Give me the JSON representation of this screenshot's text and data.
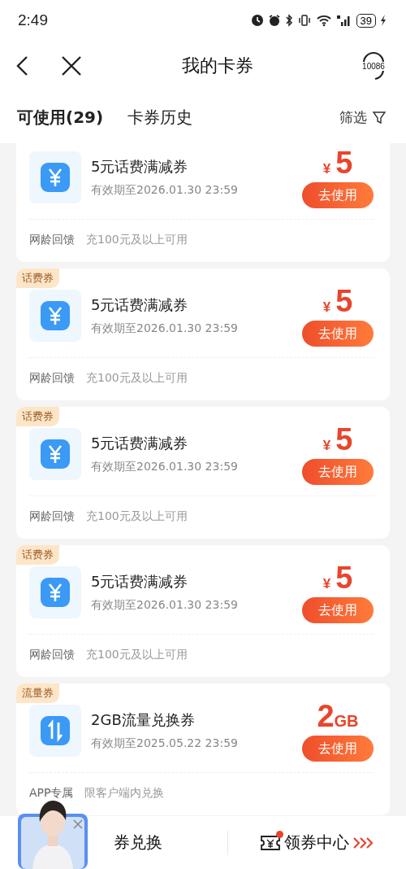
{
  "status_bar": {
    "time": "2:49",
    "battery": "39"
  },
  "header": {
    "title": "我的卡券",
    "service_badge": "10086"
  },
  "tabs": [
    {
      "label": "可使用(29)",
      "selected": true
    },
    {
      "label": "卡券历史",
      "selected": false
    }
  ],
  "filter": {
    "label": "筛选"
  },
  "coupons": [
    {
      "kind": "yuan",
      "title": "5元话费满减券",
      "expiry": "有效期至2026.01.30 23:59",
      "amount": {
        "prefix": "¥",
        "value": "5"
      },
      "button": "去使用",
      "source": "网龄回馈",
      "condition": "充100元及以上可用"
    },
    {
      "tag": "话费券",
      "kind": "yuan",
      "title": "5元话费满减券",
      "expiry": "有效期至2026.01.30 23:59",
      "amount": {
        "prefix": "¥",
        "value": "5"
      },
      "button": "去使用",
      "source": "网龄回馈",
      "condition": "充100元及以上可用"
    },
    {
      "tag": "话费券",
      "kind": "yuan",
      "title": "5元话费满减券",
      "expiry": "有效期至2026.01.30 23:59",
      "amount": {
        "prefix": "¥",
        "value": "5"
      },
      "button": "去使用",
      "source": "网龄回馈",
      "condition": "充100元及以上可用"
    },
    {
      "tag": "话费券",
      "kind": "yuan",
      "title": "5元话费满减券",
      "expiry": "有效期至2026.01.30 23:59",
      "amount": {
        "prefix": "¥",
        "value": "5"
      },
      "button": "去使用",
      "source": "网龄回馈",
      "condition": "充100元及以上可用"
    },
    {
      "tag": "流量券",
      "kind": "data",
      "title": "2GB流量兑换券",
      "expiry": "有效期至2025.05.22 23:59",
      "amount": {
        "value": "2",
        "suffix": "GB"
      },
      "button": "去使用",
      "source": "APP专属",
      "condition": "限客户端内兑换"
    }
  ],
  "bottom_bar": [
    {
      "label": "券兑换",
      "kind": "plain"
    },
    {
      "label": "领券中心",
      "kind": "ticket",
      "notification": true
    }
  ]
}
